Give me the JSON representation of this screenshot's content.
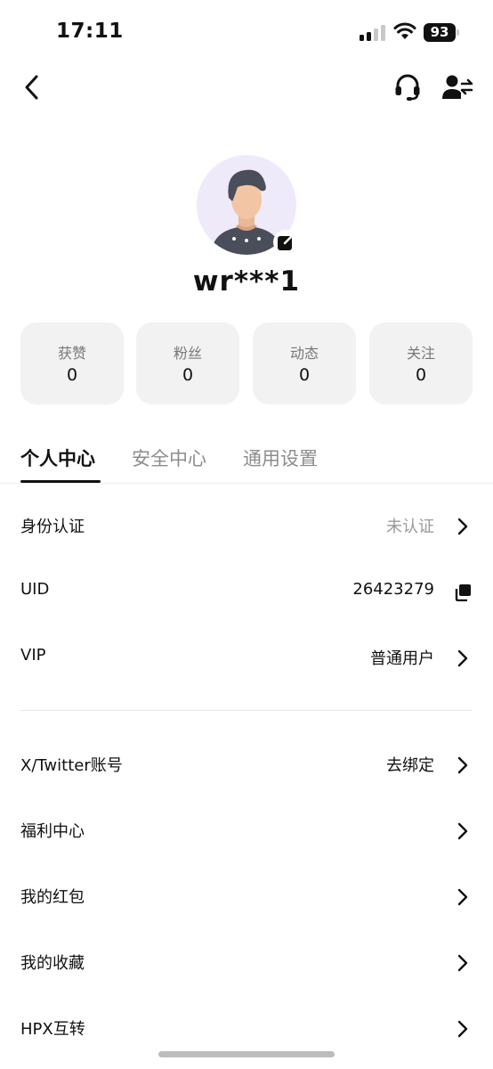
{
  "status_bar": {
    "time": "17:11",
    "battery": "93"
  },
  "profile": {
    "username": "wr***1"
  },
  "stats": [
    {
      "label": "获赞",
      "value": "0"
    },
    {
      "label": "粉丝",
      "value": "0"
    },
    {
      "label": "动态",
      "value": "0"
    },
    {
      "label": "关注",
      "value": "0"
    }
  ],
  "tabs": [
    {
      "label": "个人中心",
      "active": true
    },
    {
      "label": "安全中心",
      "active": false
    },
    {
      "label": "通用设置",
      "active": false
    }
  ],
  "account_rows": [
    {
      "label": "身份认证",
      "value": "未认证"
    },
    {
      "label": "UID",
      "value": "26423279"
    },
    {
      "label": "VIP",
      "value": "普通用户"
    }
  ],
  "menu_rows": [
    {
      "label": "X/Twitter账号",
      "value": "去绑定"
    },
    {
      "label": "福利中心",
      "value": ""
    },
    {
      "label": "我的红包",
      "value": ""
    },
    {
      "label": "我的收藏",
      "value": ""
    },
    {
      "label": "HPX互转",
      "value": ""
    }
  ],
  "icons": {
    "back": "chevron-left-icon",
    "support": "headset-icon",
    "switch_account": "user-switch-icon",
    "edit_avatar": "edit-icon",
    "copy": "copy-icon",
    "chevron": "chevron-right-icon"
  },
  "colors": {
    "avatar_bg": "#efeaf9",
    "card_bg": "#f2f2f2",
    "muted_text": "#999999"
  }
}
